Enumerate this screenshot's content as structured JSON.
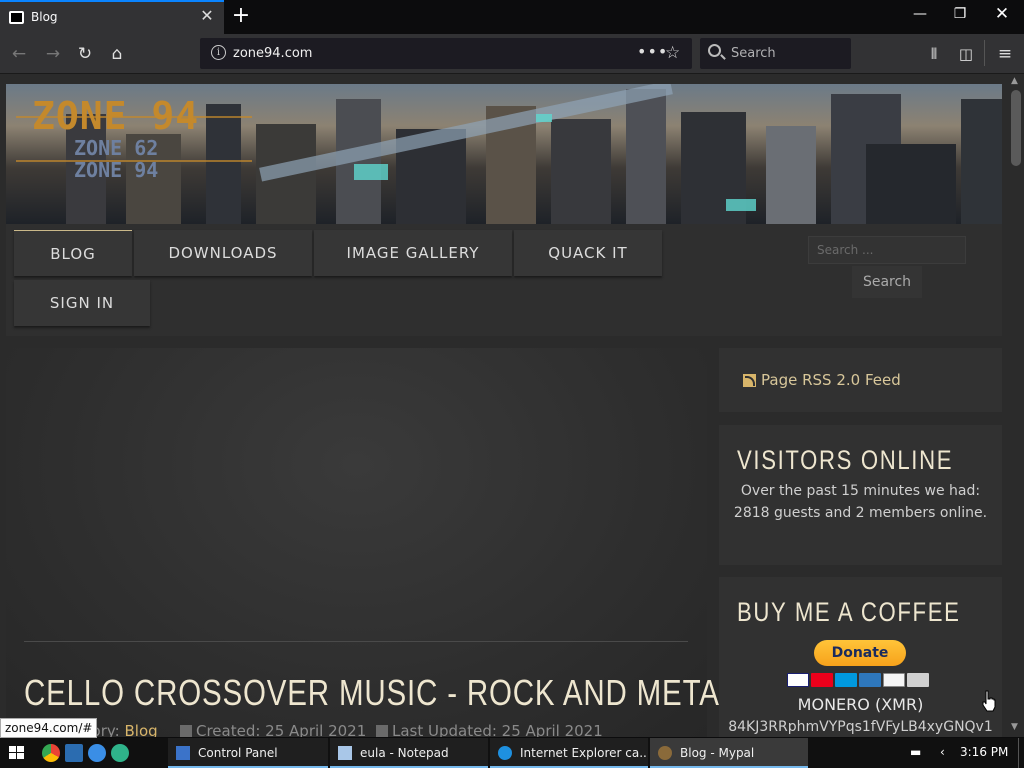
{
  "browser": {
    "tab_title": "Blog",
    "url": "zone94.com",
    "search_placeholder": "Search",
    "page_actions": "•••",
    "bookmark_star": "☆",
    "status_link": "zone94.com/#"
  },
  "site": {
    "logo_main": "ZONE 94",
    "logo_sub1": "ZONE 62",
    "logo_sub2": "ZONE 94",
    "menu": [
      "BLOG",
      "DOWNLOADS",
      "IMAGE GALLERY",
      "QUACK IT",
      "SIGN IN"
    ],
    "search_placeholder": "Search ...",
    "search_button": "Search"
  },
  "article": {
    "title": "CELLO CROSSOVER MUSIC - ROCK AND METAL",
    "category_label": "Category:",
    "category_visible_prefix": "gory:",
    "category": "Blog",
    "created": "Created: 25 April 2021",
    "updated": "Last Updated: 25 April 2021"
  },
  "sidebar": {
    "rss_label": "Page RSS 2.0 Feed",
    "visitors_title": "VISITORS ONLINE",
    "visitors_text": "Over the past 15 minutes we had: 2818 guests and 2 members online.",
    "coffee_title": "BUY ME A COFFEE",
    "donate_label": "Donate",
    "monero_label": "MONERO (XMR)",
    "monero_address": "84KJ3RRphmVYPqs1fVFyLB4xyGNQv1"
  },
  "taskbar": {
    "tasks": [
      "Control Panel",
      "eula - Notepad",
      "Internet Explorer ca...",
      "Blog - Mypal"
    ],
    "clock": "3:16 PM"
  },
  "colors": {
    "accent_gold": "#d8b56a",
    "title_cream": "#eee6cf",
    "browser_chrome": "#323234",
    "tab_highlight": "#0a84ff"
  },
  "icons": {
    "back": "arrow-left-icon",
    "forward": "arrow-right-icon",
    "reload": "reload-icon",
    "home": "home-icon",
    "library": "library-icon",
    "sidebar": "sidebar-icon",
    "menu": "hamburger-menu-icon"
  }
}
